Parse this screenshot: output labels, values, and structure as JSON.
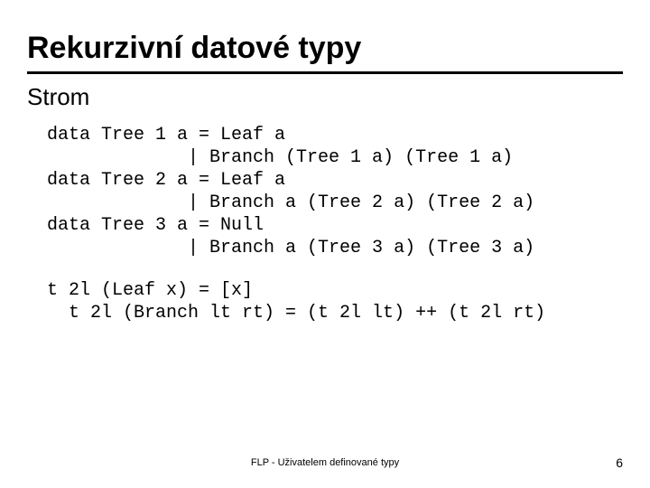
{
  "title": "Rekurzivní datové typy",
  "subtitle": "Strom",
  "code_block_1": "data Tree 1 a = Leaf a\n             | Branch (Tree 1 a) (Tree 1 a)\ndata Tree 2 a = Leaf a\n             | Branch a (Tree 2 a) (Tree 2 a)\ndata Tree 3 a = Null\n             | Branch a (Tree 3 a) (Tree 3 a)",
  "code_block_2": "t 2l (Leaf x) = [x]\n  t 2l (Branch lt rt) = (t 2l lt) ++ (t 2l rt)",
  "footer_center": "FLP - Uživatelem definované typy",
  "footer_page": "6"
}
